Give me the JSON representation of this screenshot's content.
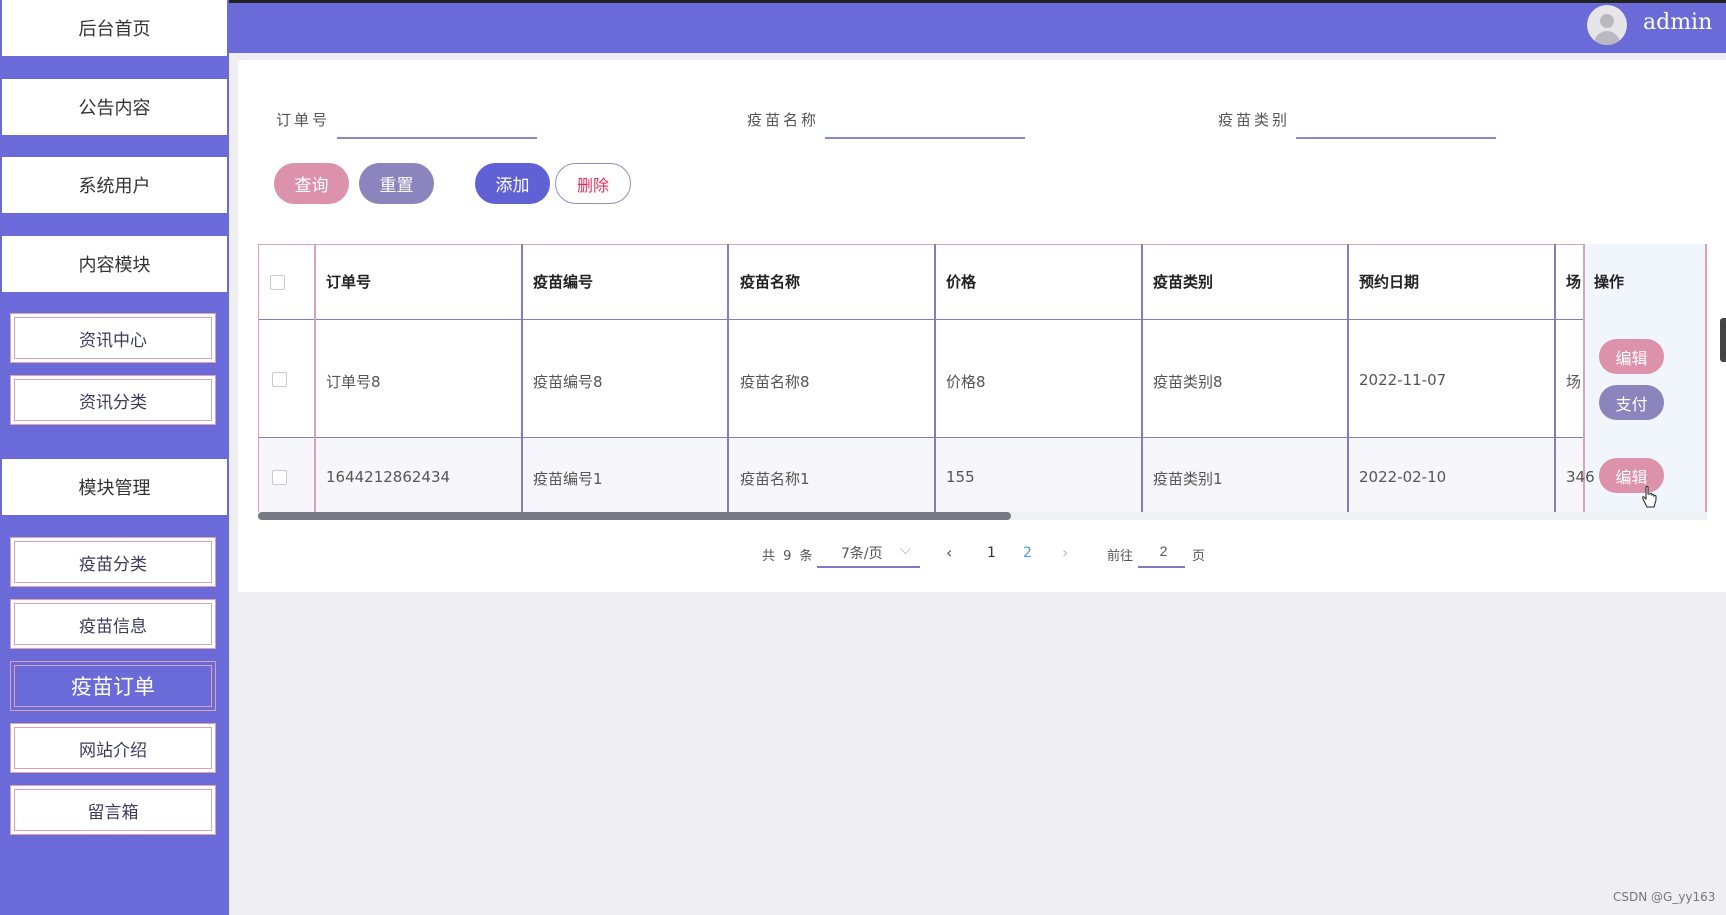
{
  "header": {
    "username": "admin"
  },
  "sidebar": {
    "main_items": [
      {
        "label": "后台首页"
      },
      {
        "label": "公告内容"
      },
      {
        "label": "系统用户"
      },
      {
        "label": "内容模块"
      },
      {
        "label": "模块管理"
      }
    ],
    "content_subitems": [
      {
        "label": "资讯中心"
      },
      {
        "label": "资讯分类"
      }
    ],
    "module_subitems": [
      {
        "label": "疫苗分类"
      },
      {
        "label": "疫苗信息"
      },
      {
        "label": "疫苗订单",
        "active": true
      },
      {
        "label": "网站介绍"
      },
      {
        "label": "留言箱"
      }
    ]
  },
  "search": {
    "fields": [
      {
        "label": "订单号",
        "value": ""
      },
      {
        "label": "疫苗名称",
        "value": ""
      },
      {
        "label": "疫苗类别",
        "value": ""
      }
    ]
  },
  "actions": {
    "query": "查询",
    "reset": "重置",
    "add": "添加",
    "delete": "删除"
  },
  "table": {
    "columns": [
      "订单号",
      "疫苗编号",
      "疫苗名称",
      "价格",
      "疫苗类别",
      "预约日期",
      "场",
      "操作"
    ],
    "rows": [
      {
        "cells": [
          "订单号8",
          "疫苗编号8",
          "疫苗名称8",
          "价格8",
          "疫苗类别8",
          "2022-11-07",
          "场"
        ],
        "buttons": [
          "编辑",
          "支付"
        ]
      },
      {
        "cells": [
          "1644212862434",
          "疫苗编号1",
          "疫苗名称1",
          "155",
          "疫苗类别1",
          "2022-02-10",
          "346"
        ],
        "buttons": [
          "编辑"
        ]
      }
    ]
  },
  "pagination": {
    "total_text": "共 9 条",
    "page_size": "7条/页",
    "prev": "‹",
    "pages": [
      "1",
      "2"
    ],
    "current_page": "2",
    "next": "›",
    "goto_label": "前往",
    "goto_value": "2",
    "goto_unit": "页"
  },
  "icons": {
    "avatar": "user-avatar-icon",
    "dropdown": "chevron-down-icon",
    "cursor": "hand-pointer-icon"
  },
  "colors": {
    "primary": "#6a6ad8",
    "pink": "#db92aa",
    "purple": "#8c84bd",
    "delete_text": "#e0305a",
    "page_active": "#409eff"
  },
  "watermark": "CSDN @G_yy163"
}
